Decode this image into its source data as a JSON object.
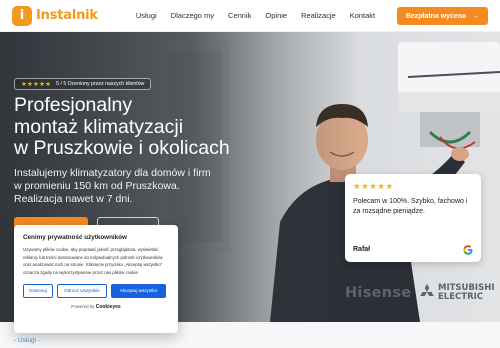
{
  "brand": {
    "name": "Instalnik"
  },
  "nav": [
    {
      "label": "Usługi"
    },
    {
      "label": "Dlaczego my"
    },
    {
      "label": "Cennik"
    },
    {
      "label": "Opinie"
    },
    {
      "label": "Realizacje"
    },
    {
      "label": "Kontakt"
    }
  ],
  "cta": {
    "label": "Bezpłatna wycena",
    "arrow": "→"
  },
  "hero": {
    "rating_stars": "★★★★★",
    "rating_text": "5 / 5 Oceniony przez naszych klientów",
    "title_lines": [
      "Profesjonalny",
      "montaż klimatyzacji",
      "w Pruszkowie i okolicach"
    ],
    "subtitle_lines": [
      "Instalujemy klimatyzatory dla domów i firm",
      "w promieniu 150 km od Pruszkowa.",
      "Realizacja nawet w 7 dni."
    ]
  },
  "review": {
    "stars": "★★★★★",
    "text": "Polecam w 100%. Szybko, fachowo i za rozsądne pieniądze.",
    "author": "Rafał",
    "source_icon": "google-icon"
  },
  "brands": {
    "hisense": "Hisense",
    "mitsubishi_line1": "MITSUBISHI",
    "mitsubishi_line2": "ELECTRIC"
  },
  "cookie": {
    "title": "Cenimy prywatność użytkowników",
    "body": "Używamy plików cookie, aby poprawić jakość przeglądania, wyświetlać reklamy lub treści dostosowane do indywidualnych potrzeb użytkowników oraz analizować ruch na stronie. Kliknięcie przycisku „Akceptuj wszystko” oznacza zgodę na wykorzystywanie przez nas plików cookie.",
    "deny_label": "Dostosuj",
    "custom_label": "Odrzuć wszystkie",
    "accept_label": "Akceptuj wszystko",
    "powered_prefix": "Powered by",
    "powered_brand": "Cookieyes"
  },
  "breadcrumb": {
    "text": "- Usługi -"
  },
  "colors": {
    "accent": "#f58a1f",
    "logo": "#f39a1c",
    "cookie_blue": "#1863dc",
    "star": "#f5b21b"
  }
}
